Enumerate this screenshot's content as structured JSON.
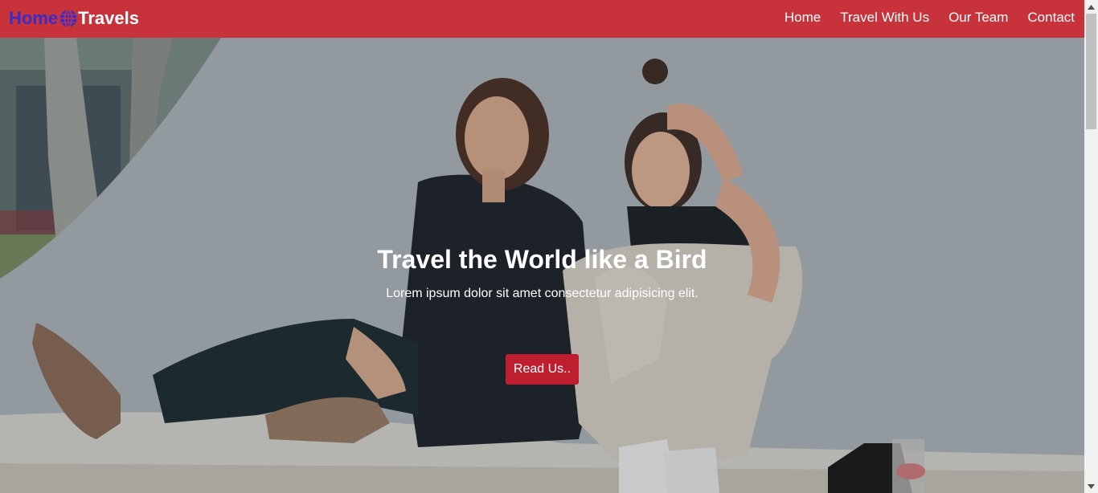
{
  "brand": {
    "home": "Home",
    "travels": "Travels",
    "icon": "globe-icon"
  },
  "nav": {
    "items": [
      {
        "label": "Home"
      },
      {
        "label": "Travel With Us"
      },
      {
        "label": "Our Team"
      },
      {
        "label": "Contact"
      }
    ]
  },
  "hero": {
    "title": "Travel the World like a Bird",
    "subtitle": "Lorem ipsum dolor sit amet consectetur adipisicing elit.",
    "cta_label": "Read Us.."
  },
  "colors": {
    "navbar": "#c8323b",
    "brand_home": "#3a2cc8",
    "cta": "#be1e2d",
    "text": "#ffffff"
  },
  "scrollbar": {
    "up_icon": "scroll-up-arrow-icon",
    "down_icon": "scroll-down-arrow-icon"
  }
}
